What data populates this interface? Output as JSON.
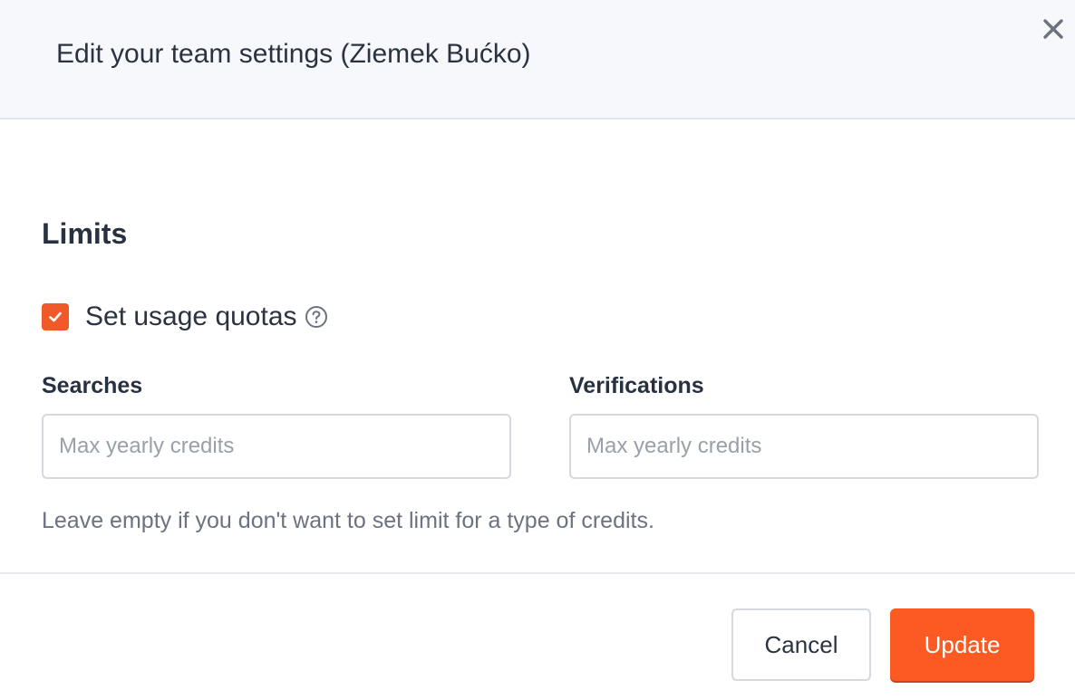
{
  "header": {
    "title": "Edit your team settings (Ziemek Bućko)",
    "close_icon": "close-icon"
  },
  "limits": {
    "section_title": "Limits",
    "quota_checkbox": {
      "label": "Set usage quotas",
      "checked": true,
      "help_icon": "help-circle-icon"
    },
    "searches": {
      "label": "Searches",
      "value": "",
      "placeholder": "Max yearly credits"
    },
    "verifications": {
      "label": "Verifications",
      "value": "",
      "placeholder": "Max yearly credits"
    },
    "hint": "Leave empty if you don't want to set limit for a type of credits."
  },
  "footer": {
    "cancel_label": "Cancel",
    "update_label": "Update"
  },
  "colors": {
    "accent": "#fc5a23",
    "header_bg": "#f6f8fb",
    "text": "#2b3340",
    "muted": "#6b7280"
  }
}
